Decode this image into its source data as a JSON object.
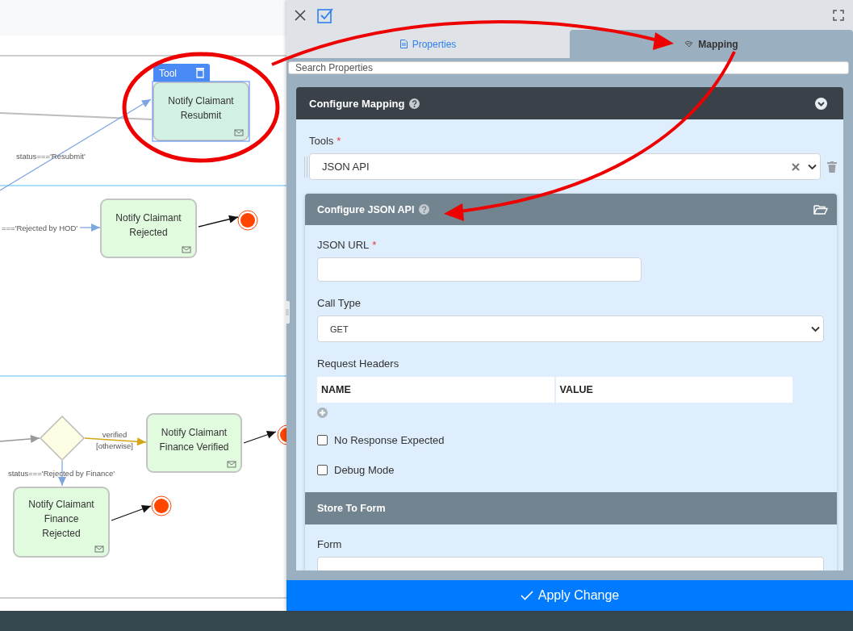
{
  "diagram": {
    "nodes": [
      {
        "kind": "task",
        "label": "Notify Claimant\nResubmit",
        "selected": true,
        "toolbar": "Tool"
      },
      {
        "kind": "task",
        "label": "Notify Claimant\nRejected",
        "selected": false
      },
      {
        "kind": "gateway",
        "selected": false
      },
      {
        "kind": "task",
        "label": "Notify Claimant\nFinance Verified",
        "selected": false
      },
      {
        "kind": "task",
        "label": "Notify Claimant\nFinance\nRejected",
        "selected": false
      },
      {
        "kind": "end",
        "selected": false
      },
      {
        "kind": "end",
        "selected": false
      },
      {
        "kind": "end",
        "selected": false
      }
    ],
    "edge_labels": [
      "status==='Resubmit'",
      "==='Rejected by HOD'",
      "verified",
      "[otherwise]",
      "status==='Rejected by Finance'"
    ]
  },
  "panel": {
    "tabs": [
      {
        "label": "Properties",
        "selected": false
      },
      {
        "label": "Mapping",
        "selected": true
      }
    ],
    "search": {
      "placeholder": "Search Properties"
    },
    "card": {
      "title": "Configure Mapping",
      "tools": {
        "label": "Tools",
        "required_mark": "*",
        "value": "JSON API"
      },
      "subcard": {
        "title": "Configure JSON API",
        "items": [
          {
            "kind": "text",
            "label": "JSON URL",
            "required_mark": "*"
          },
          {
            "kind": "select",
            "label": "Call Type",
            "value": "GET"
          },
          {
            "kind": "table",
            "label": "Request Headers",
            "columns": [
              "NAME",
              "VALUE"
            ]
          },
          {
            "kind": "checkbox",
            "label": "No Response Expected",
            "checked": false
          },
          {
            "kind": "checkbox",
            "label": "Debug Mode",
            "checked": false
          },
          {
            "kind": "section",
            "title": "Store To Form"
          },
          {
            "kind": "text",
            "label": "Form"
          }
        ]
      }
    },
    "apply_button": "Apply Change"
  }
}
